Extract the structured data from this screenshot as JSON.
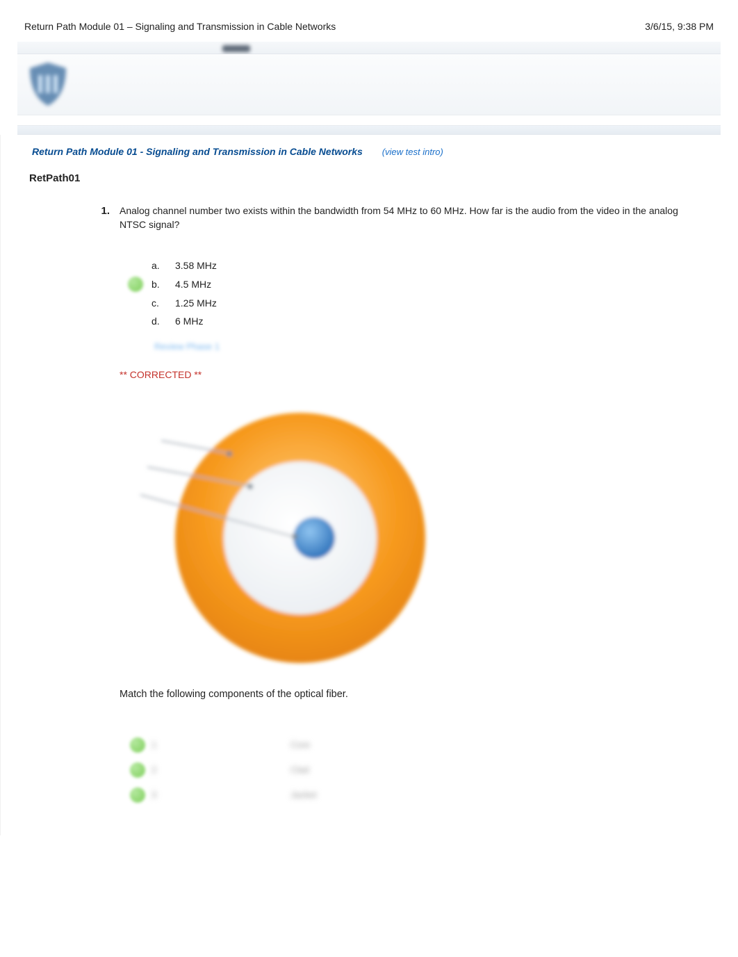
{
  "header": {
    "title": "Return Path Module 01 – Signaling and Transmission in Cable Networks",
    "timestamp": "3/6/15, 9:38 PM"
  },
  "course": {
    "title": "Return Path Module 01 - Signaling and Transmission in Cable Networks",
    "view_intro": "(view test intro)",
    "section_label": "RetPath01"
  },
  "q1": {
    "number": "1.",
    "prompt": "Analog channel number two exists within the bandwidth from 54 MHz to 60 MHz. How far is the audio from the video in the analog NTSC signal?",
    "choices": [
      {
        "letter": "a.",
        "text": "3.58 MHz",
        "correct": false
      },
      {
        "letter": "b.",
        "text": "4.5 MHz",
        "correct": true
      },
      {
        "letter": "c.",
        "text": "1.25 MHz",
        "correct": false
      },
      {
        "letter": "d.",
        "text": "6 MHz",
        "correct": false
      }
    ],
    "review_label": "Review Phase 1",
    "corrected_label": "** CORRECTED **"
  },
  "q2": {
    "prompt": "Match the following components of the optical fiber.",
    "rows": [
      {
        "num": "1",
        "ans": "Core"
      },
      {
        "num": "2",
        "ans": "Clad"
      },
      {
        "num": "3",
        "ans": "Jacket"
      }
    ]
  }
}
